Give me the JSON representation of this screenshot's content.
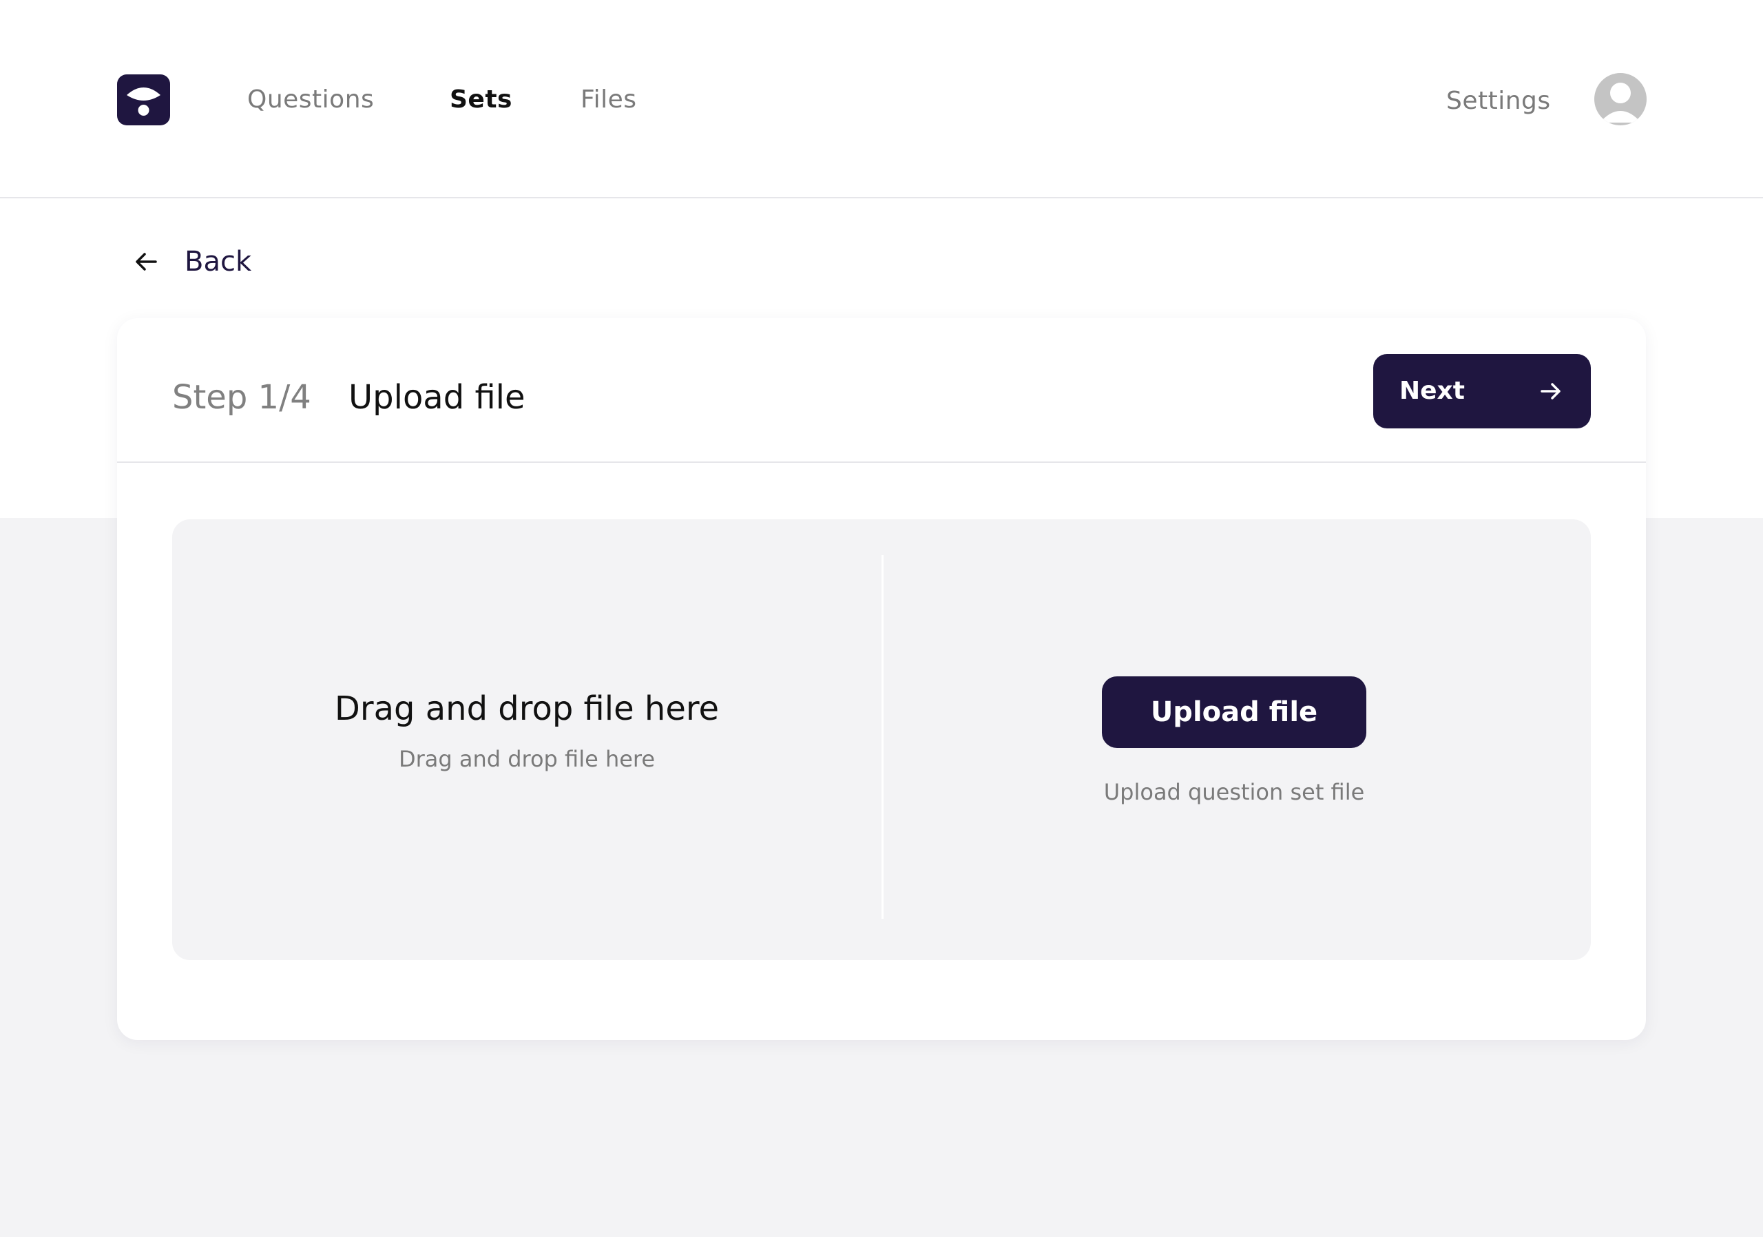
{
  "nav": {
    "items": [
      {
        "label": "Questions"
      },
      {
        "label": "Sets"
      },
      {
        "label": "Files"
      }
    ],
    "active": "Sets",
    "settings_label": "Settings"
  },
  "back": {
    "label": "Back"
  },
  "wizard": {
    "step_label": "Step 1/4",
    "step_title": "Upload file",
    "next_label": "Next"
  },
  "dropzone": {
    "title": "Drag and drop file here",
    "subtitle": "Drag and drop file here"
  },
  "upload": {
    "button_label": "Upload file",
    "caption": "Upload question set file"
  },
  "colors": {
    "primary": "#1f1640",
    "panel_bg": "#f3f3f5",
    "muted_text": "#7a7a7a"
  },
  "icons": [
    "logo-icon",
    "avatar-icon",
    "arrow-left-icon",
    "arrow-right-icon"
  ]
}
